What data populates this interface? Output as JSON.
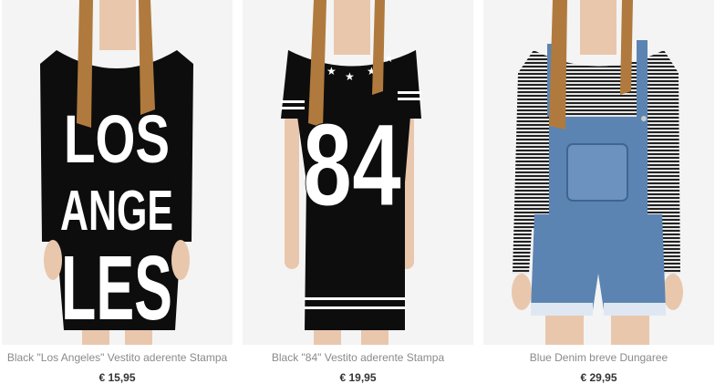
{
  "products": [
    {
      "name": "Black \"Los Angeles\" Vestito aderente Stampa",
      "price": "€ 15,95",
      "print_lines": [
        "LOS",
        "ANGE",
        "LES"
      ]
    },
    {
      "name": "Black \"84\" Vestito aderente Stampa",
      "price": "€ 19,95",
      "print_number": "84"
    },
    {
      "name": "Blue Denim breve Dungaree",
      "price": "€ 29,95"
    }
  ],
  "colors": {
    "dress": "#0d0d0d",
    "print": "#ffffff",
    "denim": "#5b84b3",
    "stripe": "#222222",
    "hair": "#b07a3e",
    "skin": "#e9c7ad"
  }
}
